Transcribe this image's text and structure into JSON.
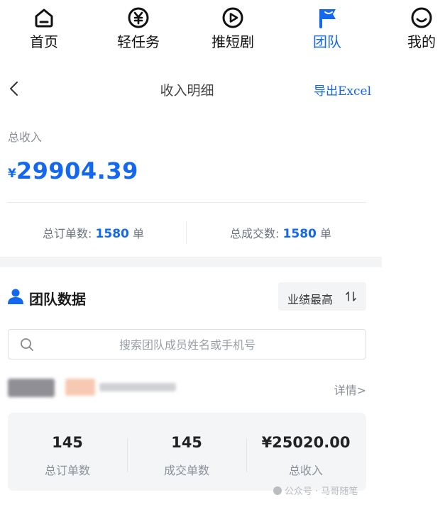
{
  "tabs": [
    {
      "label": "首页",
      "icon": "home-icon",
      "active": false
    },
    {
      "label": "轻任务",
      "icon": "yen-circle-icon",
      "active": false
    },
    {
      "label": "推短剧",
      "icon": "play-circle-icon",
      "active": false
    },
    {
      "label": "团队",
      "icon": "flag-icon",
      "active": true
    },
    {
      "label": "我的",
      "icon": "smile-icon",
      "active": false
    }
  ],
  "header": {
    "title": "收入明细",
    "export_label": "导出Excel"
  },
  "summary": {
    "total_label": "总收入",
    "currency": "¥",
    "total_amount": "29904.39",
    "orders_label": "总订单数:",
    "orders_value": "1580",
    "orders_unit": "单",
    "deals_label": "总成交数:",
    "deals_value": "1580",
    "deals_unit": "单"
  },
  "team": {
    "title": "团队数据",
    "sort_label": "业绩最高",
    "search_placeholder": "搜索团队成员姓名或手机号",
    "member": {
      "detail_label": "详情>",
      "stats": [
        {
          "value": "145",
          "label": "总订单数"
        },
        {
          "value": "145",
          "label": "成交单数"
        },
        {
          "value": "¥25020.00",
          "label": "总收入"
        }
      ]
    }
  },
  "watermark": "公众号 · 马哥随笔",
  "colors": {
    "accent": "#1468f0",
    "muted_text": "#8a8f99",
    "card_bg": "#f4f5f7"
  }
}
